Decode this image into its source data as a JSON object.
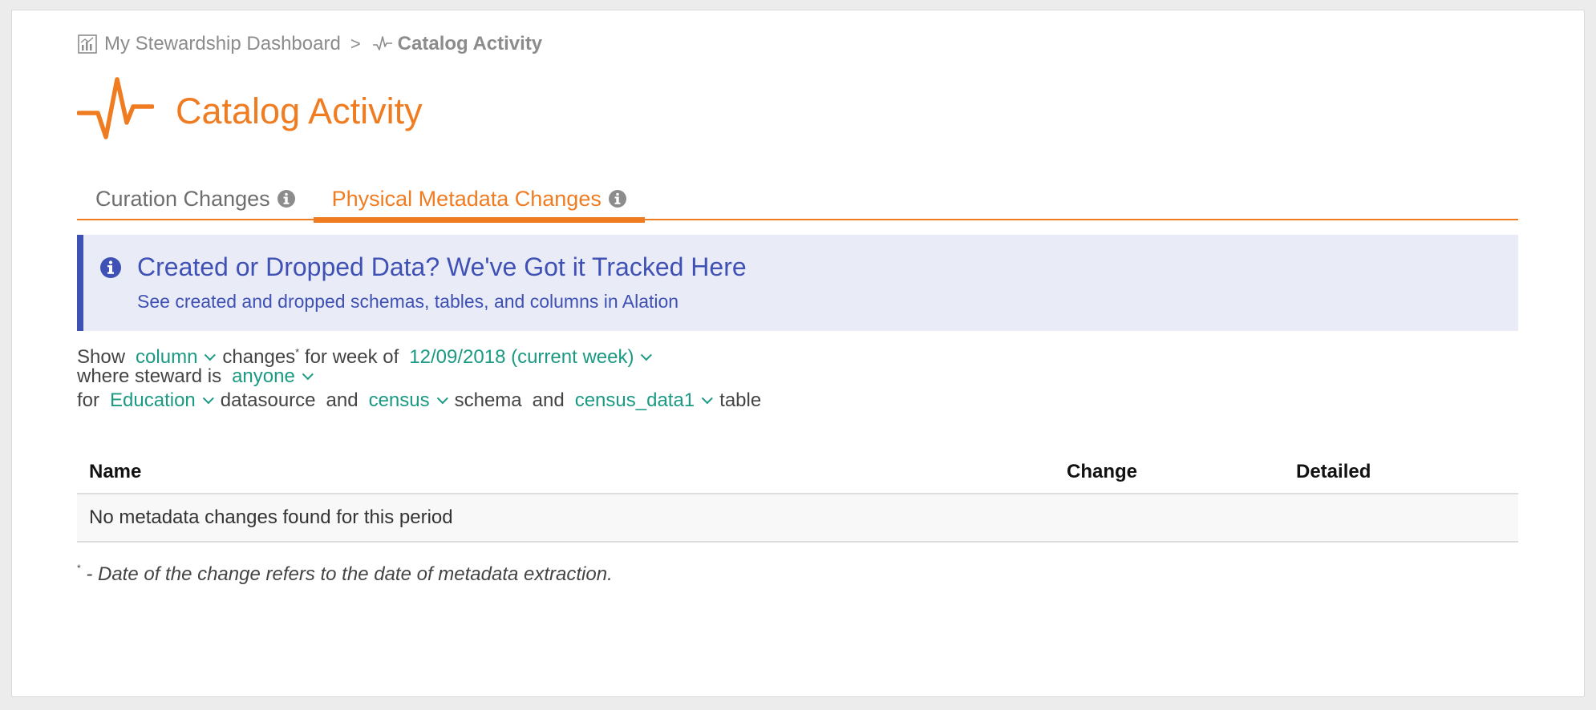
{
  "breadcrumb": {
    "parent": "My Stewardship Dashboard",
    "separator": ">",
    "current": "Catalog Activity"
  },
  "page": {
    "title": "Catalog Activity"
  },
  "tabs": [
    {
      "label": "Curation Changes",
      "active": false
    },
    {
      "label": "Physical Metadata Changes",
      "active": true
    }
  ],
  "banner": {
    "title": "Created or Dropped Data? We've Got it Tracked Here",
    "subtitle": "See created and dropped schemas, tables, and columns in Alation"
  },
  "filters": {
    "show_label": "Show",
    "object_type": "column",
    "changes_label": "changes",
    "asterisk": "*",
    "week_label": "for week of",
    "week": "12/09/2018 (current week)",
    "steward_label": "where steward is",
    "steward": "anyone",
    "for_label": "for",
    "datasource": "Education",
    "datasource_label": "datasource",
    "and_label": "and",
    "schema": "census",
    "schema_label": "schema",
    "table": "census_data1",
    "table_label": "table"
  },
  "table": {
    "columns": [
      "Name",
      "Change",
      "Detailed"
    ],
    "empty_message": "No metadata changes found for this period"
  },
  "footnote": {
    "marker": "*",
    "text": " - Date of the change refers to the date of metadata extraction."
  },
  "colors": {
    "accent": "#f07c22",
    "info": "#3f51b5",
    "link": "#1a9a83"
  }
}
